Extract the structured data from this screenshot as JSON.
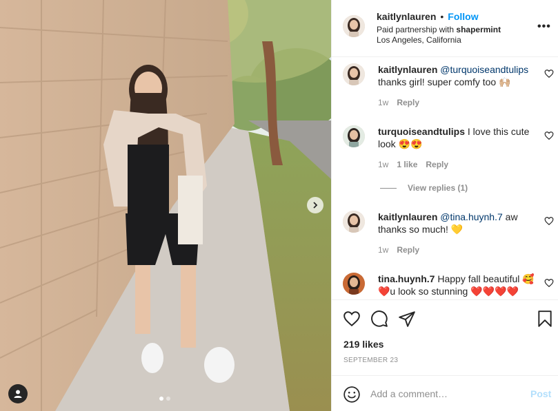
{
  "post": {
    "photo_alt": "photo",
    "carousel": {
      "slide_count": 2,
      "active_index": 0
    }
  },
  "header": {
    "username": "kaitlynlauren",
    "separator": "•",
    "follow_label": "Follow",
    "partnership_prefix": "Paid partnership with ",
    "partner": "shapermint",
    "location": "Los Angeles, California",
    "more_label": "•••"
  },
  "comments": [
    {
      "username": "kaitlynlauren",
      "mention": "@turquoiseandtulips",
      "text": "thanks girl! super comfy too 🙌🏼",
      "age": "1w",
      "likes": "",
      "reply_label": "Reply"
    },
    {
      "username": "turquoiseandtulips",
      "mention": "",
      "text": "I love this cute look 😍😍",
      "age": "1w",
      "likes": "1 like",
      "reply_label": "Reply",
      "view_replies": "View replies (1)"
    },
    {
      "username": "kaitlynlauren",
      "mention": "@tina.huynh.7",
      "text": "aw thanks so much! 💛",
      "age": "1w",
      "likes": "",
      "reply_label": "Reply"
    },
    {
      "username": "tina.huynh.7",
      "mention": "",
      "text": "Happy fall beautiful 🥰❤️u look so stunning ❤️❤️❤️❤️",
      "age": "",
      "likes": "",
      "reply_label": ""
    }
  ],
  "actions": {
    "likes": "219 likes",
    "date": "SEPTEMBER 23",
    "icons": [
      "heart-icon",
      "comment-icon",
      "share-icon",
      "save-icon"
    ]
  },
  "add_comment": {
    "placeholder": "Add a comment…",
    "post_label": "Post"
  },
  "colors": {
    "accent": "#0095f6",
    "post_disabled": "#b2dffc",
    "secondary_text": "#8e8e8e",
    "divider": "#efefef"
  }
}
